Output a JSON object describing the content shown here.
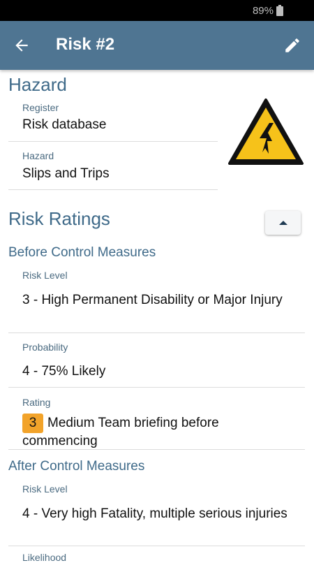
{
  "status_bar": {
    "battery_text": "89%"
  },
  "app_bar": {
    "title": "Risk #2"
  },
  "hazard_section": {
    "title": "Hazard",
    "register_label": "Register",
    "register_value": "Risk database",
    "hazard_label": "Hazard",
    "hazard_value": "Slips and Trips"
  },
  "risk_ratings": {
    "title": "Risk Ratings",
    "before": {
      "title": "Before Control Measures",
      "risk_level_label": "Risk Level",
      "risk_level_value": "3 - High  Permanent Disability or Major Injury",
      "probability_label": "Probability",
      "probability_value": "4 - 75% Likely",
      "rating_label": "Rating",
      "rating_badge": "3",
      "rating_value": "Medium  Team briefing before commencing"
    },
    "after": {
      "title": "After Control Measures",
      "risk_level_label": "Risk Level",
      "risk_level_value": "4 - Very high  Fatality, multiple serious injuries",
      "next_label": "Likelihood"
    }
  },
  "colors": {
    "app_bar": "#4f7592",
    "section_text": "#3f6a89",
    "rating_badge": "#f2a32a",
    "warning_yellow": "#f6c21a"
  },
  "icons": {
    "back": "arrow-left-icon",
    "edit": "pencil-icon",
    "hazard": "electrical-hazard-icon",
    "collapse": "chevron-up-icon",
    "battery": "battery-icon"
  }
}
